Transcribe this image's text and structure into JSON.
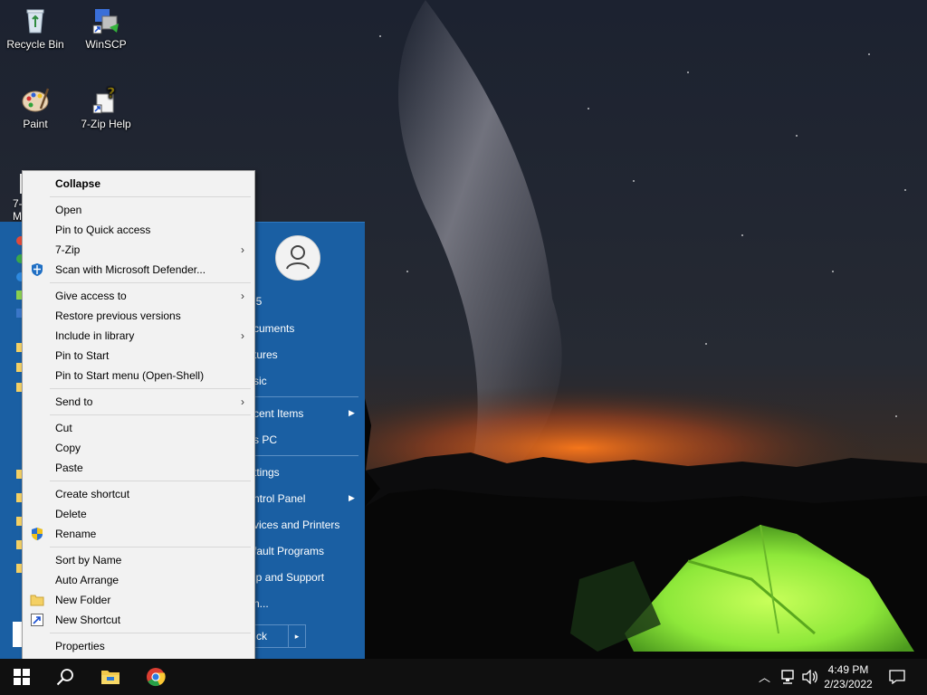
{
  "desktop": {
    "icons": [
      {
        "label": "Recycle Bin",
        "icon": "recycle-bin-icon"
      },
      {
        "label": "WinSCP",
        "icon": "winscp-icon"
      },
      {
        "label": "Paint",
        "icon": "paint-icon"
      },
      {
        "label": "7-Zip Help",
        "icon": "help-file-icon"
      }
    ],
    "partial_label_1": "7-",
    "partial_label_2": "M"
  },
  "start_menu": {
    "user_avatar_icon": "user-icon",
    "items": [
      {
        "label": "l5"
      },
      {
        "label": "cuments"
      },
      {
        "label": "tures"
      },
      {
        "label": "sic"
      },
      {
        "label": "cent Items",
        "submenu": true
      },
      {
        "label": "s PC"
      },
      {
        "label": "ttings"
      },
      {
        "label": "ntrol Panel",
        "submenu": true
      },
      {
        "label": "vices and Printers"
      },
      {
        "label": "fault Programs"
      },
      {
        "label": "lp and Support"
      },
      {
        "label": "n..."
      }
    ],
    "shutdown_label": "ck",
    "shutdown_arrow": "▸"
  },
  "context_menu": {
    "items": [
      {
        "label": "Collapse",
        "bold": true
      },
      {
        "label": "Open"
      },
      {
        "label": "Pin to Quick access"
      },
      {
        "label": "7-Zip",
        "submenu": true
      },
      {
        "label": "Scan with Microsoft Defender...",
        "icon": "defender-shield-icon"
      },
      {
        "label": "Give access to",
        "submenu": true
      },
      {
        "label": "Restore previous versions"
      },
      {
        "label": "Include in library",
        "submenu": true
      },
      {
        "label": "Pin to Start"
      },
      {
        "label": "Pin to Start menu (Open-Shell)"
      },
      {
        "label": "Send to",
        "submenu": true
      },
      {
        "label": "Cut"
      },
      {
        "label": "Copy"
      },
      {
        "label": "Paste"
      },
      {
        "label": "Create shortcut"
      },
      {
        "label": "Delete"
      },
      {
        "label": "Rename",
        "icon": "uac-shield-icon"
      },
      {
        "label": "Sort by Name"
      },
      {
        "label": "Auto Arrange"
      },
      {
        "label": "New Folder",
        "icon": "folder-icon"
      },
      {
        "label": "New Shortcut",
        "icon": "shortcut-icon"
      },
      {
        "label": "Properties"
      }
    ],
    "chevron": "›"
  },
  "taskbar": {
    "start_icon": "windows-logo-icon",
    "search_icon": "search-icon",
    "pinned": [
      "file-explorer-icon",
      "chrome-icon"
    ],
    "tray": {
      "chevron": "︿",
      "network_icon": "network-icon",
      "volume_icon": "volume-icon",
      "notifications_icon": "action-center-icon"
    },
    "clock": {
      "time": "4:49 PM",
      "date": "2/23/2022"
    }
  },
  "colors": {
    "start_menu_blue": "#1a5fa3",
    "context_menu_bg": "#f2f2f2",
    "taskbar": "#101010",
    "tent_green": "#8ee83a"
  }
}
